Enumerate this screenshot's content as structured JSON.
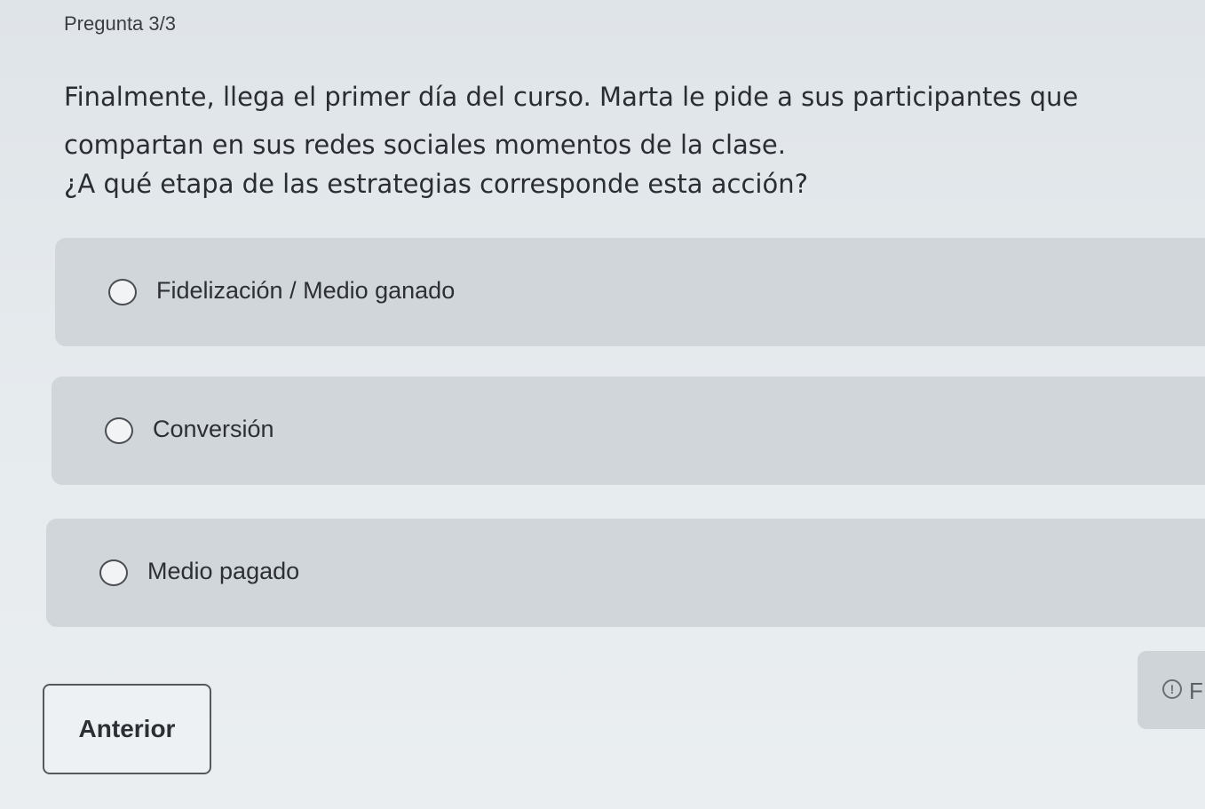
{
  "header": {
    "counter": "Pregunta 3/3"
  },
  "question": {
    "line1": "Finalmente, llega el primer día del curso. Marta le pide a sus participantes que",
    "line2": "compartan en sus redes sociales momentos de la clase.",
    "ask": "¿A qué etapa de las estrategias corresponde esta acción?"
  },
  "options": [
    {
      "label": "Fidelización / Medio ganado",
      "selected": false
    },
    {
      "label": "Conversión",
      "selected": false
    },
    {
      "label": "Medio pagado",
      "selected": false
    }
  ],
  "footer": {
    "prev_label": "Anterior",
    "next_icon": "alert-circle-icon",
    "next_label_visible": "F"
  }
}
